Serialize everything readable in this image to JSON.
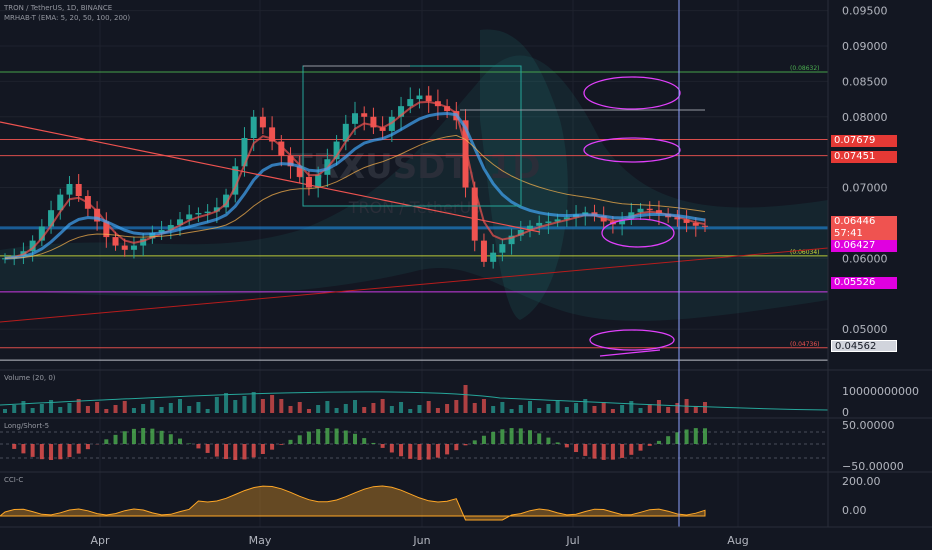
{
  "header": {
    "symbol_line": "TRON / TetherUS, 1D, BINANCE",
    "indicator_line": "MRHAB-T (EMA: 5, 20, 50, 100, 200)"
  },
  "watermark": {
    "big": "TRXUSDT, 1D",
    "small": "TRON / TetherUS"
  },
  "colors": {
    "background": "#131722",
    "grid": "#1e222d",
    "text": "#b2b5be",
    "red": "#ef5350",
    "green": "#26a69a",
    "magenta": "#e040fb",
    "pink": "#f50fe0",
    "cursor": "#8ea0ff"
  },
  "price_tags": {
    "t1": {
      "value": "0.07679",
      "color": "#e53935"
    },
    "t2": {
      "value": "0.07451",
      "color": "#e53935"
    },
    "current": {
      "value": "0.06446",
      "countdown": "57:41",
      "color": "#ef5350"
    },
    "t3": {
      "value": "0.06427",
      "color": "#e000e0"
    },
    "t4": {
      "value": "0.05526",
      "color": "#e000e0"
    },
    "t5": {
      "value": "0.04562",
      "color": "#d1d4dc"
    }
  },
  "chart_data": [
    {
      "type": "candlestick",
      "title": "TRXUSDT, 1D",
      "x_ticks": [
        "Apr",
        "May",
        "Jun",
        "Jul",
        "Aug"
      ],
      "y_ticks": [
        "0.09500",
        "0.09000",
        "0.08500",
        "0.08000",
        "0.07000",
        "0.06000",
        "0.05000"
      ],
      "ylim": [
        0.0445,
        0.0965
      ],
      "horizontal_levels": [
        {
          "value": 0.08632,
          "label": "(0.08632)",
          "color": "#4caf50"
        },
        {
          "value": 0.07679,
          "color": "#ef5350"
        },
        {
          "value": 0.07451,
          "color": "#ef5350"
        },
        {
          "value": 0.0643,
          "color": "#2196f3"
        },
        {
          "value": 0.06034,
          "label": "(0.06034)",
          "color": "#cddc39"
        },
        {
          "value": 0.05526,
          "color": "#e040fb"
        },
        {
          "value": 0.04736,
          "label": "(0.04736)",
          "color": "#ef5350"
        },
        {
          "value": 0.04562,
          "color": "#d1d4dc"
        }
      ],
      "close_series": [
        0.06,
        0.0604,
        0.061,
        0.0625,
        0.0645,
        0.0668,
        0.069,
        0.0705,
        0.0688,
        0.067,
        0.0652,
        0.063,
        0.0618,
        0.0612,
        0.0618,
        0.0628,
        0.0636,
        0.064,
        0.0647,
        0.0655,
        0.0662,
        0.0664,
        0.0666,
        0.0672,
        0.069,
        0.073,
        0.077,
        0.08,
        0.0785,
        0.0765,
        0.0745,
        0.073,
        0.0715,
        0.07,
        0.0718,
        0.074,
        0.0765,
        0.079,
        0.0805,
        0.08,
        0.0785,
        0.078,
        0.08,
        0.0815,
        0.0825,
        0.083,
        0.0822,
        0.0815,
        0.0808,
        0.0795,
        0.07,
        0.0625,
        0.0595,
        0.0608,
        0.062,
        0.0632,
        0.064,
        0.0646,
        0.065,
        0.0652,
        0.0655,
        0.0658,
        0.0662,
        0.0665,
        0.066,
        0.0652,
        0.0648,
        0.0655,
        0.0665,
        0.067,
        0.0668,
        0.0663,
        0.0658,
        0.0655,
        0.065,
        0.0646,
        0.0645
      ]
    },
    {
      "type": "bar",
      "title": "Volume (20, 0)",
      "y_ticks": [
        "10000000000",
        "0"
      ]
    },
    {
      "type": "bar",
      "title": "Long/Short-5",
      "y_ticks": [
        "50.00000",
        "−50.00000"
      ]
    },
    {
      "type": "area",
      "title": "CCI-C",
      "y_ticks": [
        "200.00",
        "0.00"
      ]
    }
  ]
}
